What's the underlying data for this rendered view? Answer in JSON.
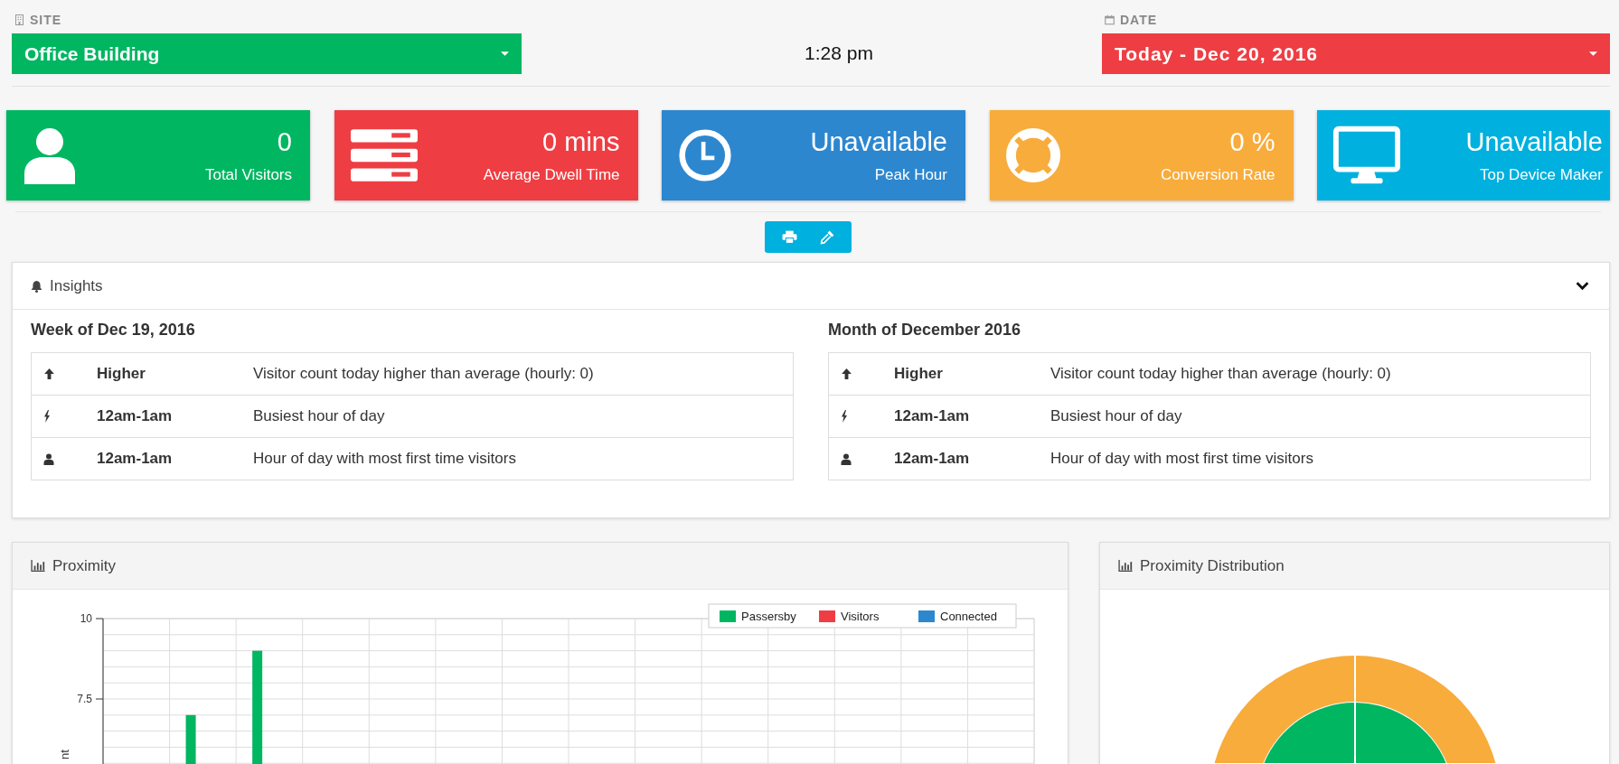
{
  "site": {
    "label": "SITE",
    "value": "Office Building"
  },
  "time": "1:28 pm",
  "date": {
    "label": "DATE",
    "value": "Today - Dec 20, 2016"
  },
  "stats": [
    {
      "kind": "user",
      "value": "0",
      "label": "Total Visitors",
      "color": "#00b661"
    },
    {
      "kind": "server",
      "value": "0 mins",
      "label": "Average Dwell Time",
      "color": "#ee3e43"
    },
    {
      "kind": "clock",
      "value": "Unavailable",
      "label": "Peak Hour",
      "color": "#2d87cf"
    },
    {
      "kind": "lifebuoy",
      "value": "0 %",
      "label": "Conversion Rate",
      "color": "#f8ac3b"
    },
    {
      "kind": "monitor",
      "value": "Unavailable",
      "label": "Top Device Maker",
      "color": "#00b0de"
    }
  ],
  "insights": {
    "title": "Insights",
    "expanded": true,
    "groups": [
      {
        "title": "Week of Dec 19, 2016",
        "rows": [
          {
            "kind": "up",
            "value": "Higher",
            "text": "Visitor count today higher than average (hourly: 0)"
          },
          {
            "kind": "bolt",
            "value": "12am-1am",
            "text": "Busiest hour of day"
          },
          {
            "kind": "user",
            "value": "12am-1am",
            "text": "Hour of day with most first time visitors"
          }
        ]
      },
      {
        "title": "Month of December 2016",
        "rows": [
          {
            "kind": "up",
            "value": "Higher",
            "text": "Visitor count today higher than average (hourly: 0)"
          },
          {
            "kind": "bolt",
            "value": "12am-1am",
            "text": "Busiest hour of day"
          },
          {
            "kind": "user",
            "value": "12am-1am",
            "text": "Hour of day with most first time visitors"
          }
        ]
      }
    ]
  },
  "proximity": {
    "title": "Proximity",
    "y_axis_label": "nt",
    "y_ticks": [
      "10",
      "7.5"
    ],
    "legend": [
      {
        "name": "Passersby",
        "color": "#00b661"
      },
      {
        "name": "Visitors",
        "color": "#ee3e43"
      },
      {
        "name": "Connected",
        "color": "#2d87cf"
      }
    ]
  },
  "distribution": {
    "title": "Proximity Distribution"
  }
}
